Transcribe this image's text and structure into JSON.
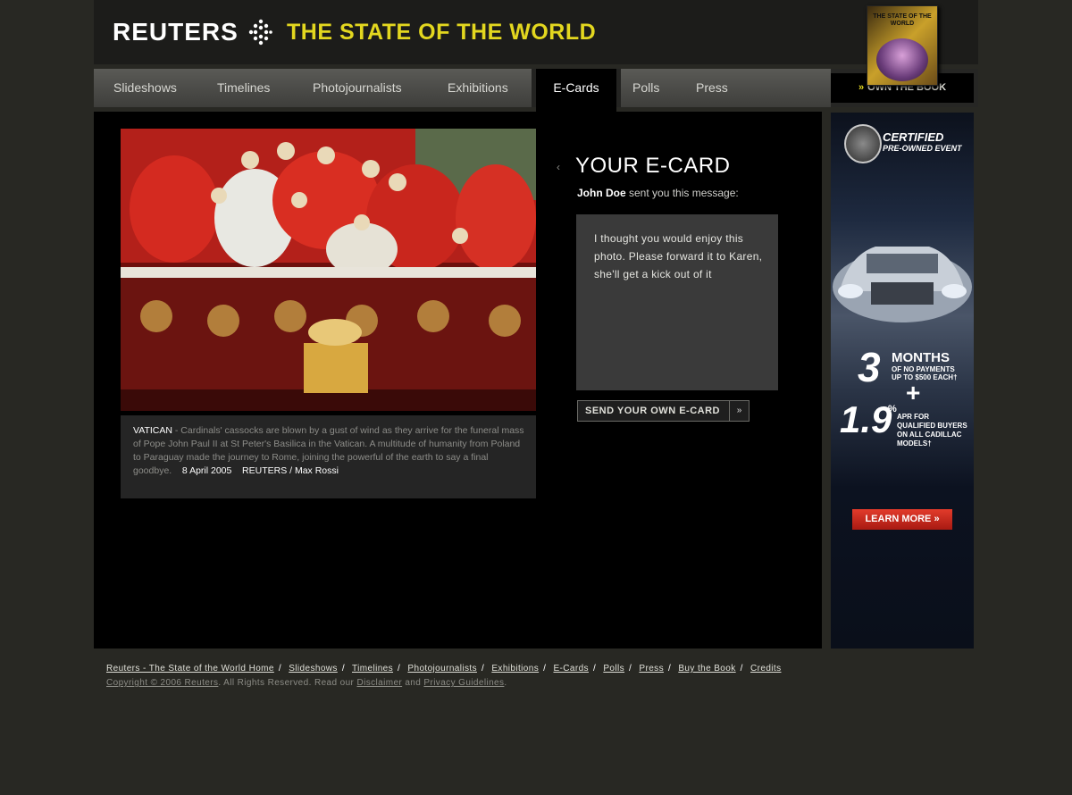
{
  "header": {
    "logo": "REUTERS",
    "site_title": "THE STATE OF THE WORLD",
    "book_title": "THE STATE OF THE WORLD"
  },
  "nav": {
    "items": [
      {
        "label": "Slideshows"
      },
      {
        "label": "Timelines"
      },
      {
        "label": "Photojournalists"
      },
      {
        "label": "Exhibitions"
      },
      {
        "label": "E-Cards"
      },
      {
        "label": "Polls"
      },
      {
        "label": "Press"
      }
    ],
    "active": "E-Cards",
    "own_book": "OWN THE BOOK"
  },
  "photo": {
    "caption_place": "VATICAN",
    "caption_text": " - Cardinals' cassocks are blown by a gust of wind as they arrive for the funeral mass of Pope John Paul II at St Peter's Basilica in the Vatican. A multitude of humanity from Poland to Paraguay made the journey to Rome, joining the powerful of the earth to say a final goodbye.",
    "date": "8 April 2005",
    "credit": "REUTERS / Max Rossi"
  },
  "ecard": {
    "title": "YOUR E-CARD",
    "sender": "John Doe",
    "sender_suffix": " sent you this message:",
    "message": "I thought you would enjoy this photo. Please forward it to Karen, she'll get a kick out of it",
    "send_label": "SEND YOUR OWN E-CARD"
  },
  "ad": {
    "certified": "CERTIFIED",
    "event": "PRE-OWNED EVENT",
    "months_num": "3",
    "months": "MONTHS",
    "no_payments": "OF NO PAYMENTS",
    "up_to": "UP TO $500 EACH†",
    "plus": "+",
    "apr_num": "1.9",
    "apr_pct": "%",
    "apr_text": "APR FOR QUALIFIED BUYERS ON ALL CADILLAC MODELS†",
    "learn_more": "LEARN MORE »"
  },
  "footer": {
    "links": [
      "Reuters - The State of the World Home",
      "Slideshows",
      "Timelines",
      "Photojournalists",
      "Exhibitions",
      "E-Cards",
      "Polls",
      "Press",
      "Buy the Book",
      "Credits"
    ],
    "copyright": "Copyright © 2006 Reuters",
    "rights": ". All Rights Reserved. Read our ",
    "disclaimer": "Disclaimer",
    "and": " and ",
    "privacy": "Privacy Guidelines",
    "end": "."
  }
}
